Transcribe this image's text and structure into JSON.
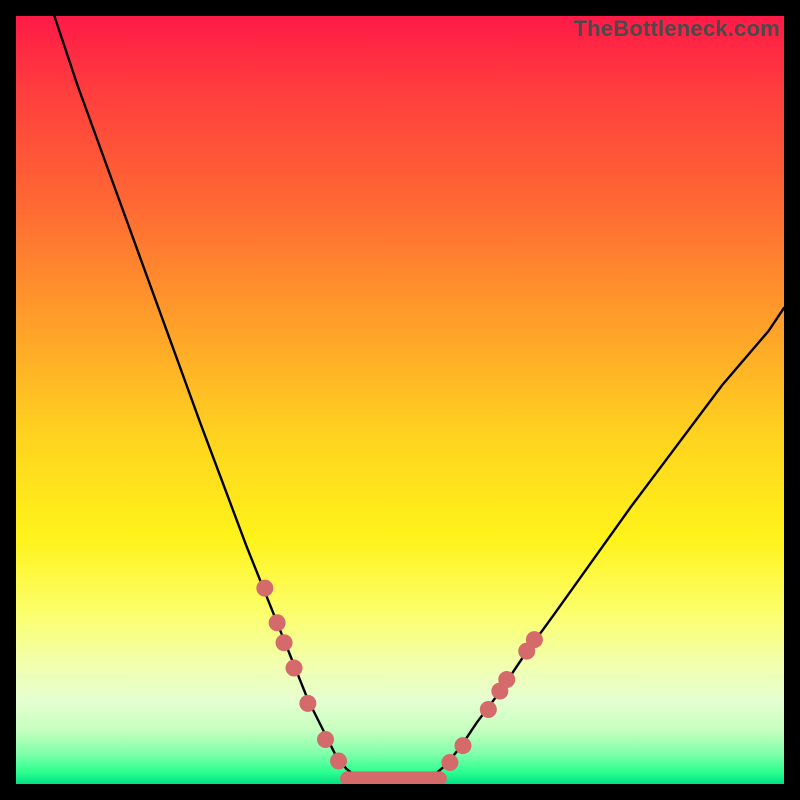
{
  "attribution": "TheBottleneck.com",
  "chart_data": {
    "type": "line",
    "title": "",
    "xlabel": "",
    "ylabel": "",
    "xlim": [
      0,
      100
    ],
    "ylim": [
      0,
      100
    ],
    "series": [
      {
        "name": "left-curve",
        "x": [
          5,
          8,
          12,
          16,
          20,
          24,
          27,
          30,
          32,
          34,
          36,
          38,
          40,
          41.5,
          43,
          44.5
        ],
        "y": [
          100,
          91,
          80,
          69,
          58,
          47,
          39,
          31,
          26,
          21,
          16,
          11,
          7,
          4,
          2,
          0.8
        ]
      },
      {
        "name": "valley-floor",
        "x": [
          44.5,
          46,
          48,
          50,
          52,
          54
        ],
        "y": [
          0.8,
          0.4,
          0.3,
          0.3,
          0.4,
          0.8
        ]
      },
      {
        "name": "right-curve",
        "x": [
          54,
          56,
          58,
          60,
          63,
          66,
          70,
          75,
          80,
          86,
          92,
          98,
          100
        ],
        "y": [
          0.8,
          2.5,
          5,
          8,
          12,
          16.5,
          22,
          29,
          36,
          44,
          52,
          59,
          62
        ]
      }
    ],
    "markers": {
      "name": "highlight-dots",
      "color": "#d46a6a",
      "points": [
        {
          "x": 32.4,
          "y": 25.5
        },
        {
          "x": 34.0,
          "y": 21.0
        },
        {
          "x": 34.9,
          "y": 18.4
        },
        {
          "x": 36.2,
          "y": 15.1
        },
        {
          "x": 38.0,
          "y": 10.5
        },
        {
          "x": 40.3,
          "y": 5.8
        },
        {
          "x": 42.0,
          "y": 3.0
        },
        {
          "x": 56.5,
          "y": 2.8
        },
        {
          "x": 58.2,
          "y": 5.0
        },
        {
          "x": 61.5,
          "y": 9.7
        },
        {
          "x": 63.0,
          "y": 12.1
        },
        {
          "x": 63.9,
          "y": 13.6
        },
        {
          "x": 66.5,
          "y": 17.3
        },
        {
          "x": 67.5,
          "y": 18.8
        }
      ]
    },
    "valley_bar": {
      "color": "#d46a6a",
      "x0": 42.2,
      "x1": 56.1,
      "y": 0.7,
      "thickness": 1.9
    }
  }
}
